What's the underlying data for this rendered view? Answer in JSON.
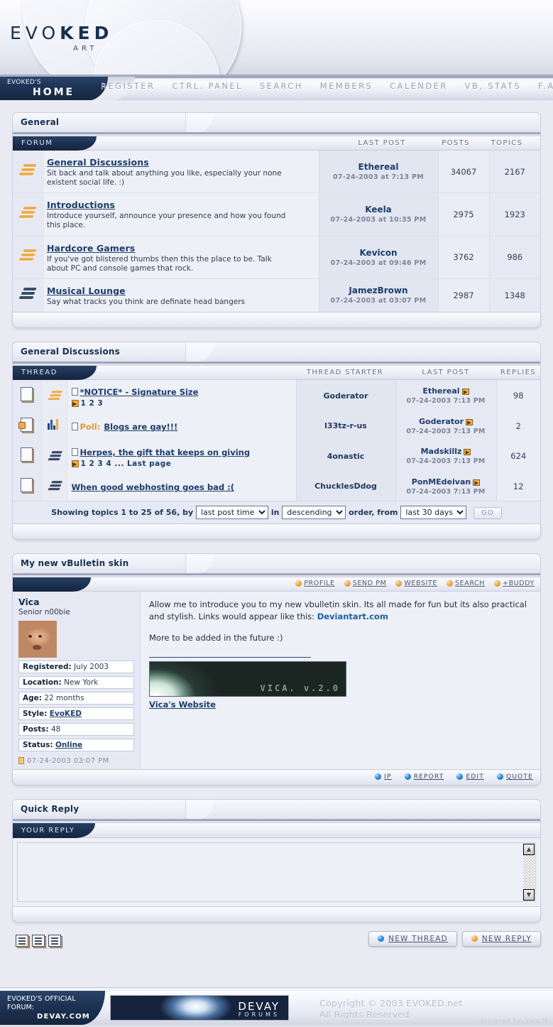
{
  "site": {
    "logo_main_prefix": "EVO",
    "logo_main_bold": "KED",
    "logo_sub": "ART"
  },
  "nav": {
    "home_kicker": "EVOKED'S",
    "home_label": "HOME",
    "links": [
      {
        "label": "REGISTER"
      },
      {
        "label": "CTRL. PANEL"
      },
      {
        "label": "SEARCH"
      },
      {
        "label": "MEMBERS"
      },
      {
        "label": "CALENDER"
      },
      {
        "label": "VB, STATS"
      },
      {
        "label": "F.A.Q."
      }
    ]
  },
  "forum_panel": {
    "title": "General",
    "columns": {
      "forum": "FORUM",
      "last_post": "LAST POST",
      "posts": "POSTS",
      "topics": "TOPICS"
    },
    "rows": [
      {
        "name": "General Discussions",
        "desc": "Sit back and talk about anything you like, especially your none existent social life. :)",
        "last_user": "Ethereal",
        "last_date": "07-24-2003 at 7:13 PM",
        "posts": "34067",
        "topics": "2167",
        "icon_color": "orange"
      },
      {
        "name": "Introductions",
        "desc": "Introduce yourself, announce your presence and how you found this place.",
        "last_user": "Keela",
        "last_date": "07-24-2003 at 10:35 PM",
        "posts": "2975",
        "topics": "1923",
        "icon_color": "orange"
      },
      {
        "name": "Hardcore Gamers",
        "desc": "If you've got blistered thumbs then this the place to be. Talk about PC and console games that rock.",
        "last_user": "Kevicon",
        "last_date": "07-24-2003 at 09:46 PM",
        "posts": "3762",
        "topics": "986",
        "icon_color": "orange"
      },
      {
        "name": "Musical Lounge",
        "desc": "Say what tracks you think are definate head bangers",
        "last_user": "JamezBrown",
        "last_date": "07-24-2003 at 03:07 PM",
        "posts": "2987",
        "topics": "1348",
        "icon_color": "dark"
      }
    ]
  },
  "thread_panel": {
    "title": "General Discussions",
    "columns": {
      "thread": "THREAD",
      "starter": "THREAD STARTER",
      "last_post": "LAST POST",
      "replies": "REPLIES"
    },
    "rows": [
      {
        "title": "*NOTICE* - Signature Size",
        "prefix": "",
        "pages": "1 2 3",
        "starter": "Goderator",
        "last_user": "Ethereal",
        "last_date": "07-24-2003 7:13 PM",
        "replies": "98",
        "has_pages": true,
        "is_poll": false,
        "locked": false
      },
      {
        "title": "Blogs are gay!!!",
        "prefix": "Poll:",
        "pages": "",
        "starter": "l33tz-r-us",
        "last_user": "Goderator",
        "last_date": "07-24-2003 7:13 PM",
        "replies": "2",
        "has_pages": false,
        "is_poll": true,
        "locked": true
      },
      {
        "title": "Herpes, the gift that keeps on giving",
        "prefix": "",
        "pages": "1 2 3 4 ... Last page",
        "starter": "4onastic",
        "last_user": "Madskillz",
        "last_date": "07-24-2003 7:13 PM",
        "replies": "624",
        "has_pages": true,
        "is_poll": false,
        "locked": false
      },
      {
        "title": "When good webhosting goes bad :(",
        "prefix": "",
        "pages": "",
        "starter": "ChucklesDdog",
        "last_user": "PonMEdeivan",
        "last_date": "07-24-2003 7:13 PM",
        "replies": "12",
        "has_pages": false,
        "is_poll": false,
        "locked": false
      }
    ],
    "showbar": {
      "text_1": "Showing topics 1 to 25 of 56, by",
      "sort_selected": "last post time",
      "text_2": "in",
      "order_selected": "descending",
      "text_3": "order, from",
      "range_selected": "last 30 days",
      "go_label": "GO"
    }
  },
  "post_panel": {
    "title": "My new vBulletin skin",
    "actions": [
      {
        "label": "PROFILE",
        "color": "orange"
      },
      {
        "label": "SEND PM",
        "color": "orange"
      },
      {
        "label": "WEBSITE",
        "color": "orange"
      },
      {
        "label": "SEARCH",
        "color": "orange"
      },
      {
        "label": "+BUDDY",
        "color": "orange"
      }
    ],
    "author": {
      "name": "Vica",
      "rank": "Senior n00bie",
      "fields": [
        {
          "label": "Registered:",
          "value": "July 2003",
          "link": false
        },
        {
          "label": "Location:",
          "value": "New York",
          "link": false
        },
        {
          "label": "Age:",
          "value": "22 months",
          "link": false
        },
        {
          "label": "Style:",
          "value": "EvoKED",
          "link": true
        },
        {
          "label": "Posts:",
          "value": "48",
          "link": false
        },
        {
          "label": "Status:",
          "value": "Online",
          "link": true
        }
      ],
      "timestamp": "07-24-2003 03:07 PM"
    },
    "message": {
      "para1_a": "Allow me to introduce you to my new vbulletin skin. Its all made for fun but its also practical and stylish. Links would appear like this: ",
      "para1_link": "Deviantart.com",
      "para2": "More to be added in the future :)"
    },
    "signature": {
      "banner_text": "VICA. v.2.0",
      "link": "Vica's Website"
    },
    "footer_buttons": [
      {
        "label": "IP",
        "color": "blue"
      },
      {
        "label": "REPORT",
        "color": "blue"
      },
      {
        "label": "EDIT",
        "color": "blue"
      },
      {
        "label": "QUOTE",
        "color": "blue"
      }
    ]
  },
  "quick_reply": {
    "title": "Quick Reply",
    "tab_label": "YOUR REPLY",
    "textarea_value": ""
  },
  "bottom_bar": {
    "buttons": [
      {
        "label": "NEW THREAD",
        "color": "blue"
      },
      {
        "label": "NEW REPLY",
        "color": "orange"
      }
    ]
  },
  "footer": {
    "official_line1": "EVOKED'S OFFICIAL",
    "official_line2": "FORUM:",
    "official_site": "DEVAY.COM",
    "banner_title": "DEVAY",
    "banner_sub": "FORUMS",
    "copyright_line1": "Copyright © 2003 EVOKED.net",
    "copyright_line2": "All Rights Reserved",
    "designed_by": "designed by: Vica.tk"
  },
  "colors": {
    "page_bg": "#e9eaf2",
    "navy": "#17304f",
    "link": "#1d3d6b",
    "accent_orange": "#f0ac4c",
    "accent_blue": "#2f8fe0"
  }
}
